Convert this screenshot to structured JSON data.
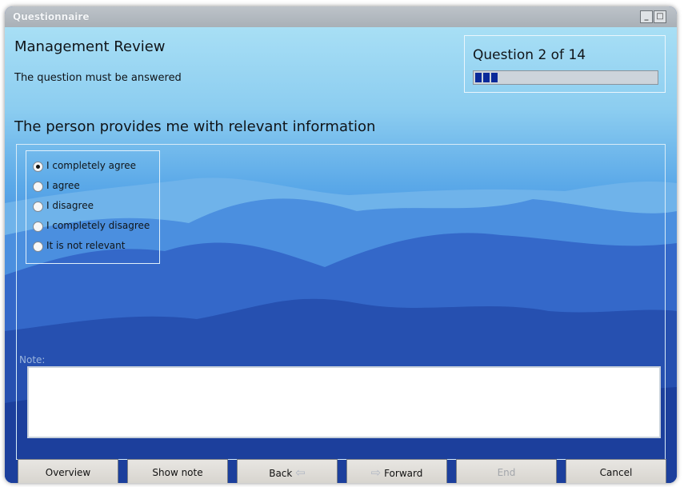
{
  "window": {
    "title": "Questionnaire",
    "minimize_glyph": "_",
    "maximize_glyph": "□"
  },
  "header": {
    "title": "Management Review",
    "subtitle": "The question must be answered"
  },
  "progress": {
    "label": "Question 2 of 14",
    "current": 2,
    "total": 14
  },
  "question": {
    "text": "The person provides me with relevant information"
  },
  "options": [
    {
      "label": "I completely agree",
      "selected": true
    },
    {
      "label": "I agree",
      "selected": false
    },
    {
      "label": "I disagree",
      "selected": false
    },
    {
      "label": "I completely disagree",
      "selected": false
    },
    {
      "label": "It is not relevant",
      "selected": false
    }
  ],
  "note": {
    "label": "Note:",
    "value": ""
  },
  "buttons": {
    "overview": "Overview",
    "show_note": "Show note",
    "back": "Back",
    "forward": "Forward",
    "end": "End",
    "cancel": "Cancel"
  },
  "icons": {
    "back_arrow": "⇦",
    "forward_arrow": "⇨"
  }
}
